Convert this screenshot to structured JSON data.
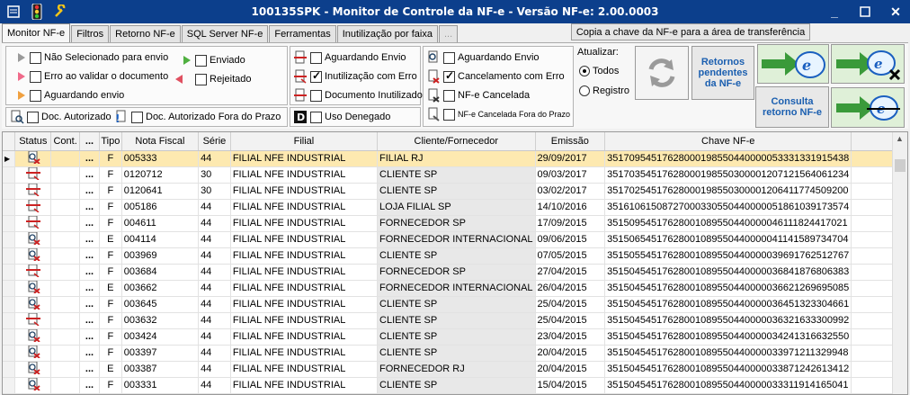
{
  "window": {
    "title": "100135SPK - Monitor de Controle da NF-e - Versão NF-e: 2.00.0003"
  },
  "tabs": [
    {
      "label": "Monitor NF-e"
    },
    {
      "label": "Filtros"
    },
    {
      "label": "Retorno NF-e"
    },
    {
      "label": "SQL Server NF-e"
    },
    {
      "label": "Ferramentas"
    },
    {
      "label": "Inutilização por faixa"
    },
    {
      "label": "..."
    }
  ],
  "copy_button": "Copia a chave da NF-e para a área de transferência",
  "legend": {
    "col1": [
      {
        "label": "Não Selecionado para envio",
        "color": "#9a9a9a",
        "dir": "right",
        "checked": false
      },
      {
        "label": "Erro ao validar o documento",
        "color": "#f06a8a",
        "dir": "right",
        "checked": false
      },
      {
        "label": "Aguardando envio",
        "color": "#f0a040",
        "dir": "right",
        "checked": false
      }
    ],
    "col1b": [
      {
        "label": "Enviado",
        "color": "#50b040",
        "dir": "right",
        "checked": false
      },
      {
        "label": "Rejeitado",
        "color": "#e05060",
        "dir": "left",
        "checked": false
      }
    ],
    "doc_autorizado": "Doc. Autorizado",
    "doc_fora_prazo": "Doc. Autorizado Fora do Prazo",
    "col2": [
      {
        "label": "Aguardando Envio",
        "checked": false
      },
      {
        "label": "Inutilização com Erro",
        "checked": true
      },
      {
        "label": "Documento Inutilizado",
        "checked": false
      }
    ],
    "uso_denegado": "Uso Denegado",
    "col3": [
      {
        "label": "Aguardando Envio",
        "checked": false
      },
      {
        "label": "Cancelamento com Erro",
        "checked": true
      },
      {
        "label": "NF-e Cancelada",
        "checked": false
      },
      {
        "label": "NF-e Cancelada Fora do Prazo",
        "checked": false
      }
    ]
  },
  "atualizar": {
    "label": "Atualizar:",
    "options": [
      {
        "label": "Todos",
        "selected": true
      },
      {
        "label": "Registro",
        "selected": false
      }
    ]
  },
  "buttons": {
    "retornos": "Retornos pendentes da NF-e",
    "consulta": "Consulta retorno NF-e"
  },
  "grid": {
    "columns": [
      "Status",
      "Cont.",
      "...",
      "Tipo",
      "Nota Fiscal",
      "Série",
      "Filial",
      "Cliente/Fornecedor",
      "Emissão",
      "Chave NF-e"
    ],
    "rows": [
      [
        "...",
        "F",
        "005333",
        "44",
        "FILIAL NFE INDUSTRIAL",
        "FILIAL RJ",
        "29/09/2017",
        "35170954517628000198550440000053331331915438"
      ],
      [
        "...",
        "F",
        "0120712",
        "30",
        "FILIAL NFE INDUSTRIAL",
        "CLIENTE SP",
        "09/03/2017",
        "35170354517628000198550300001207121564061234"
      ],
      [
        "...",
        "F",
        "0120641",
        "30",
        "FILIAL NFE INDUSTRIAL",
        "CLIENTE SP",
        "03/02/2017",
        "35170254517628000198550300001206411774509200"
      ],
      [
        "...",
        "F",
        "005186",
        "44",
        "FILIAL NFE INDUSTRIAL",
        "LOJA FILIAL SP",
        "14/10/2016",
        "35161061508727000330550440000051861039173574"
      ],
      [
        "...",
        "F",
        "004611",
        "44",
        "FILIAL NFE INDUSTRIAL",
        "FORNECEDOR SP",
        "17/09/2015",
        "35150954517628001089550440000046111824417021"
      ],
      [
        "...",
        "E",
        "004114",
        "44",
        "FILIAL NFE INDUSTRIAL",
        "FORNECEDOR INTERNACIONAL",
        "09/06/2015",
        "35150654517628001089550440000041141589734704"
      ],
      [
        "...",
        "F",
        "003969",
        "44",
        "FILIAL NFE INDUSTRIAL",
        "CLIENTE SP",
        "07/05/2015",
        "35150554517628001089550440000039691762512767"
      ],
      [
        "...",
        "F",
        "003684",
        "44",
        "FILIAL NFE INDUSTRIAL",
        "FORNECEDOR SP",
        "27/04/2015",
        "35150454517628001089550440000036841876806383"
      ],
      [
        "...",
        "E",
        "003662",
        "44",
        "FILIAL NFE INDUSTRIAL",
        "FORNECEDOR INTERNACIONAL",
        "26/04/2015",
        "35150454517628001089550440000036621269695085"
      ],
      [
        "...",
        "F",
        "003645",
        "44",
        "FILIAL NFE INDUSTRIAL",
        "CLIENTE SP",
        "25/04/2015",
        "35150454517628001089550440000036451323304661"
      ],
      [
        "...",
        "F",
        "003632",
        "44",
        "FILIAL NFE INDUSTRIAL",
        "CLIENTE SP",
        "25/04/2015",
        "35150454517628001089550440000036321633300992"
      ],
      [
        "...",
        "F",
        "003424",
        "44",
        "FILIAL NFE INDUSTRIAL",
        "CLIENTE SP",
        "23/04/2015",
        "35150454517628001089550440000034241316632550"
      ],
      [
        "...",
        "F",
        "003397",
        "44",
        "FILIAL NFE INDUSTRIAL",
        "CLIENTE SP",
        "20/04/2015",
        "35150454517628001089550440000033971211329948"
      ],
      [
        "...",
        "E",
        "003387",
        "44",
        "FILIAL NFE INDUSTRIAL",
        "FORNECEDOR RJ",
        "20/04/2015",
        "35150454517628001089550440000033871242613412"
      ],
      [
        "...",
        "F",
        "003331",
        "44",
        "FILIAL NFE INDUSTRIAL",
        "CLIENTE SP",
        "15/04/2015",
        "35150454517628001089550440000033311914165041"
      ]
    ]
  }
}
